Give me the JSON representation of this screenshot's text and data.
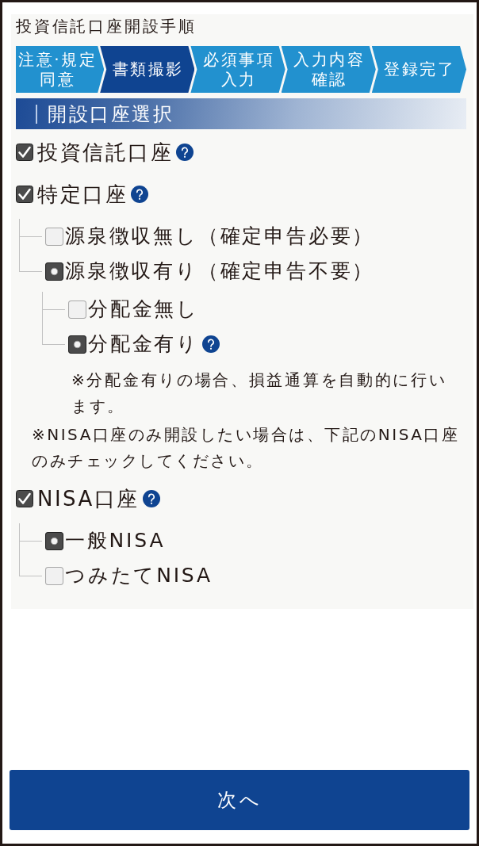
{
  "header": {
    "title": "投資信託口座開設手順"
  },
  "steps": [
    {
      "lines": [
        "注意·規定",
        "同意"
      ],
      "selected": false
    },
    {
      "lines": [
        "書類撮影"
      ],
      "selected": true
    },
    {
      "lines": [
        "必須事項",
        "入力"
      ],
      "selected": false
    },
    {
      "lines": [
        "入力内容",
        "確認"
      ],
      "selected": false
    },
    {
      "lines": [
        "登録完了"
      ],
      "selected": false
    }
  ],
  "section": {
    "title": "開設口座選択"
  },
  "options": [
    {
      "kind": "checkbox",
      "label": "投資信託口座",
      "checked": true,
      "help": true
    },
    {
      "kind": "checkbox",
      "label": "特定口座",
      "checked": true,
      "help": true,
      "children": [
        {
          "kind": "radio",
          "label": "源泉徴収無し（確定申告必要）",
          "selected": false,
          "help": false
        },
        {
          "kind": "radio",
          "label": "源泉徴収有り（確定申告不要）",
          "selected": true,
          "help": false,
          "children": [
            {
              "kind": "radio",
              "label": "分配金無し",
              "selected": false,
              "help": false
            },
            {
              "kind": "radio",
              "label": "分配金有り",
              "selected": true,
              "help": true
            }
          ],
          "note": "※分配金有りの場合、損益通算を自動的に行います。"
        }
      ]
    },
    {
      "kind": "note",
      "text": "※NISA口座のみ開設したい場合は、下記のNISA口座のみチェックしてください。"
    },
    {
      "kind": "checkbox",
      "label": "NISA口座",
      "checked": true,
      "help": true,
      "children": [
        {
          "kind": "radio",
          "label": "一般NISA",
          "selected": true,
          "help": false
        },
        {
          "kind": "radio",
          "label": "つみたてNISA",
          "selected": false,
          "help": false
        }
      ]
    }
  ],
  "next_button": {
    "label": "次へ"
  }
}
